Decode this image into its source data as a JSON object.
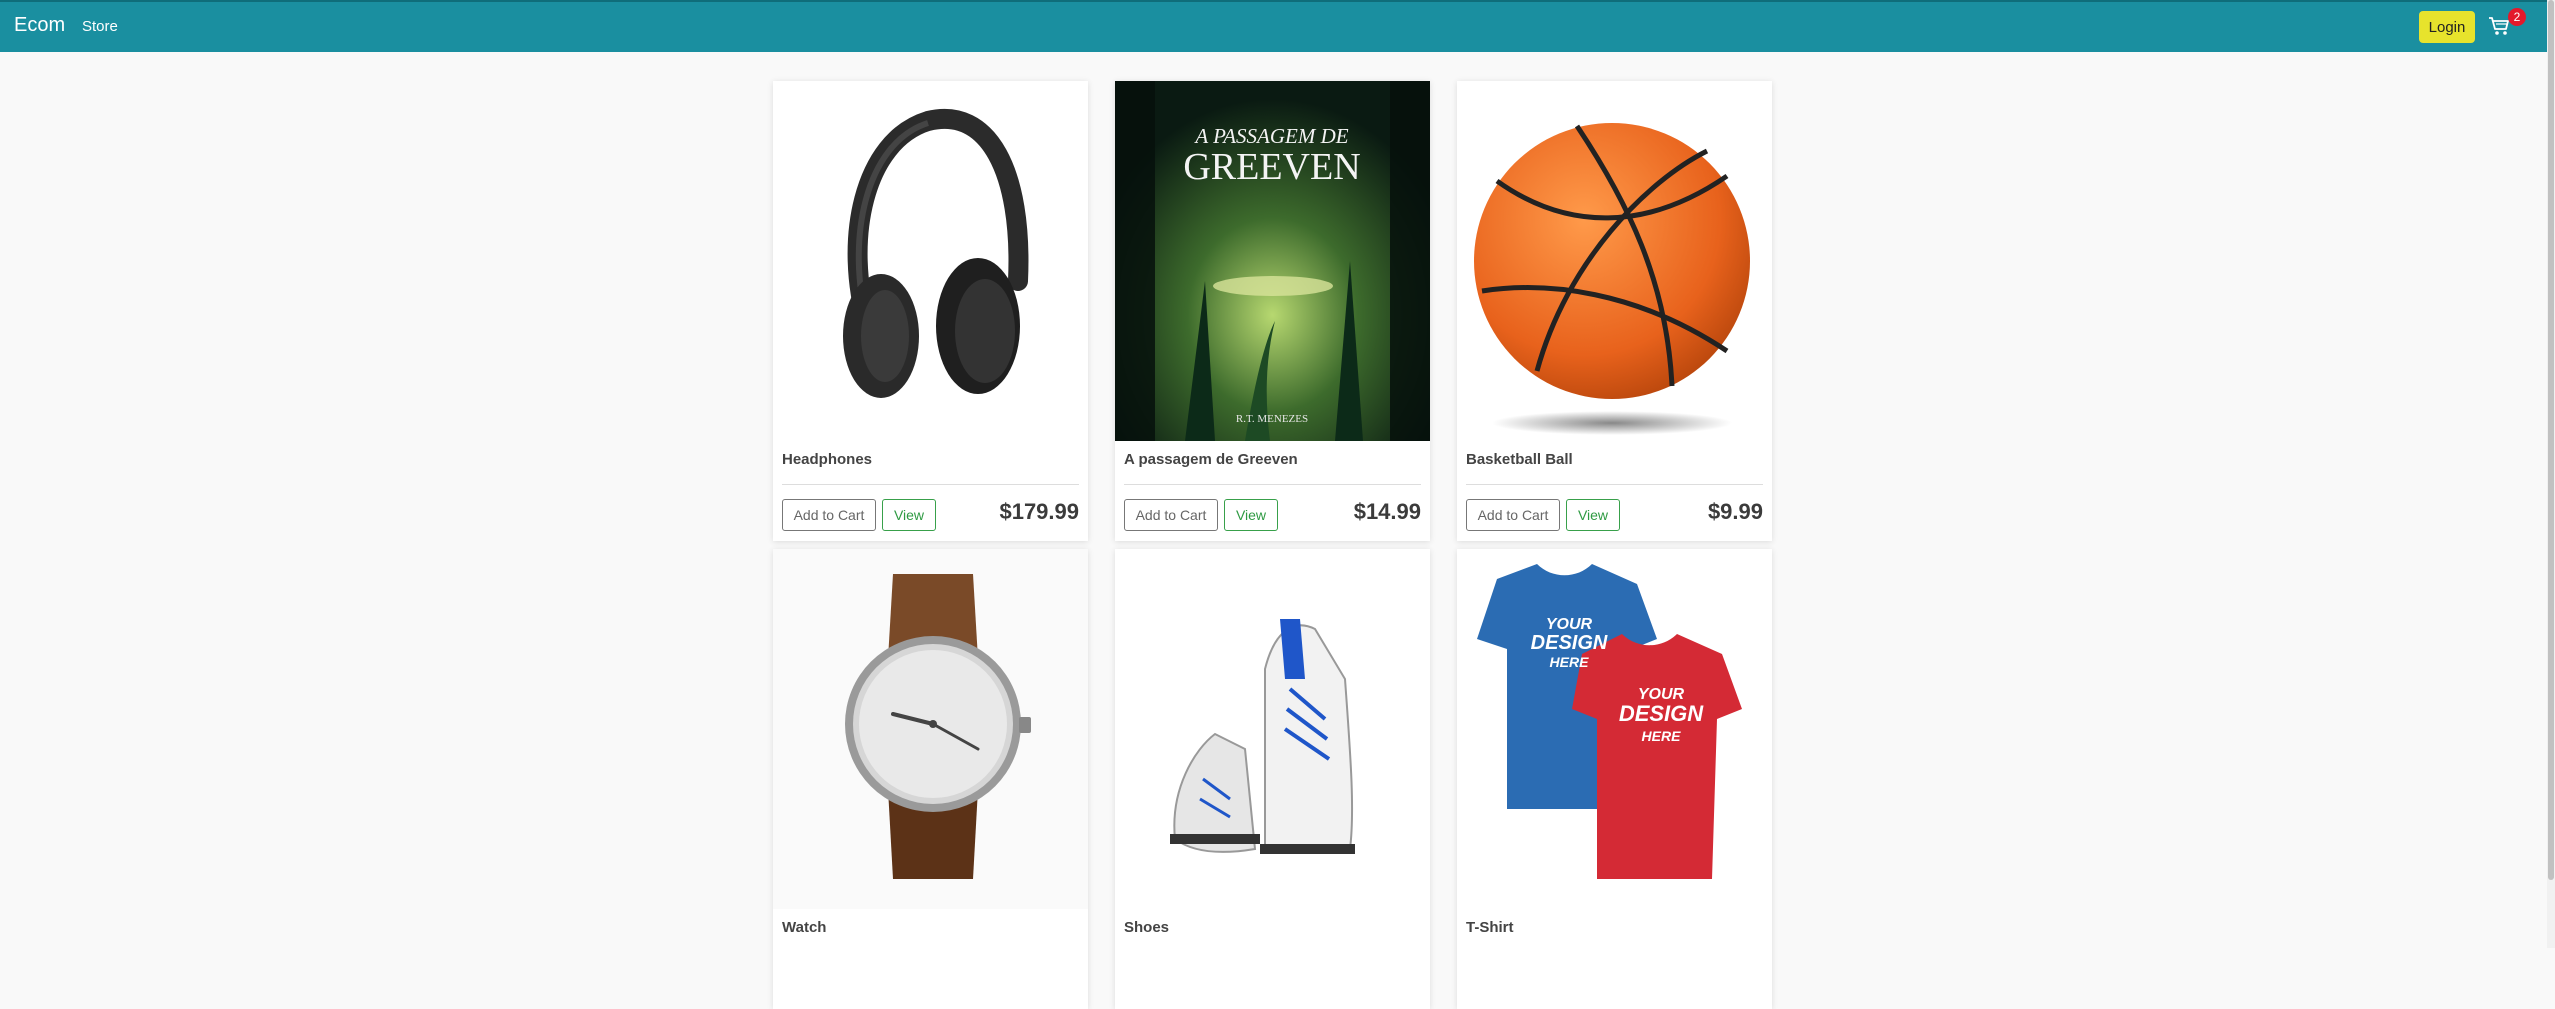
{
  "navbar": {
    "brand": "Ecom",
    "links": [
      "Store"
    ],
    "login_label": "Login",
    "cart_count": "2"
  },
  "colors": {
    "navbar": "#1a8fa0",
    "login": "#e7e32c",
    "badge": "#e3192b",
    "view_button": "#2e9a42"
  },
  "products": [
    {
      "name": "Headphones",
      "price": "$179.99",
      "add_label": "Add to Cart",
      "view_label": "View",
      "image": "headphones-image"
    },
    {
      "name": "A passagem de Greeven",
      "price": "$14.99",
      "add_label": "Add to Cart",
      "view_label": "View",
      "image": "book-cover-image",
      "cover_title_line1": "A PASSAGEM DE",
      "cover_title_line2": "GREEVEN",
      "cover_author": "R.T. MENEZES"
    },
    {
      "name": "Basketball Ball",
      "price": "$9.99",
      "add_label": "Add to Cart",
      "view_label": "View",
      "image": "basketball-image"
    },
    {
      "name": "Watch",
      "image": "watch-image"
    },
    {
      "name": "Shoes",
      "image": "shoes-image"
    },
    {
      "name": "T-Shirt",
      "image": "tshirt-image",
      "shirt_text": [
        "YOUR",
        "DESIGN",
        "HERE"
      ]
    }
  ]
}
